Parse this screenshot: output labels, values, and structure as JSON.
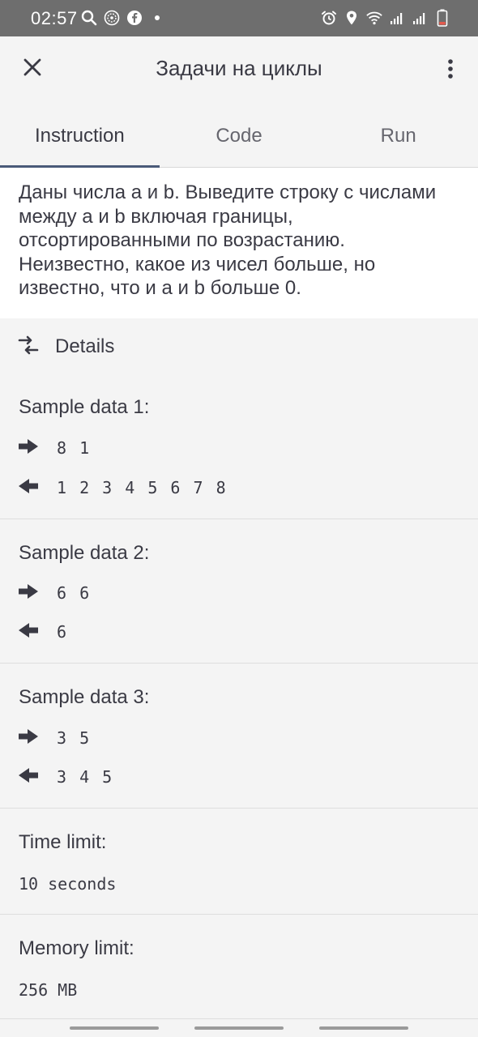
{
  "status_bar": {
    "time": "02:57",
    "left_icons": [
      "search-icon",
      "vpn-icon",
      "facebook-icon",
      "dot-icon"
    ],
    "right_icons": [
      "alarm-icon",
      "location-icon",
      "wifi-icon",
      "signal-icon",
      "signal-icon-2",
      "battery-low-icon"
    ]
  },
  "app_bar": {
    "title": "Задачи на циклы",
    "close_icon": "close-icon",
    "more_icon": "more-vert-icon"
  },
  "tabs": [
    {
      "label": "Instruction",
      "active": true
    },
    {
      "label": "Code",
      "active": false
    },
    {
      "label": "Run",
      "active": false
    }
  ],
  "instruction": {
    "text": "Даны числа a и b. Выведите строку с числами между a и b включая границы, отсортированными по возрастанию. Неизвестно, какое из чисел больше, но известно, что и a и b больше 0."
  },
  "details": {
    "label": "Details",
    "icon": "swap-icon"
  },
  "samples": [
    {
      "title": "Sample data 1:",
      "input": "8 1",
      "output": "1 2 3 4 5 6 7 8"
    },
    {
      "title": "Sample data 2:",
      "input": "6 6",
      "output": "6"
    },
    {
      "title": "Sample data 3:",
      "input": "3 5",
      "output": "3 4 5"
    }
  ],
  "limits": {
    "time_label": "Time limit:",
    "time_value": "10 seconds",
    "memory_label": "Memory limit:",
    "memory_value": "256 MB"
  },
  "colors": {
    "status_bar_bg": "#6e6e6e",
    "background": "#f4f4f4",
    "instruction_bg": "#ffffff",
    "text": "#3a3a44",
    "tab_indicator": "#4a5a78"
  }
}
